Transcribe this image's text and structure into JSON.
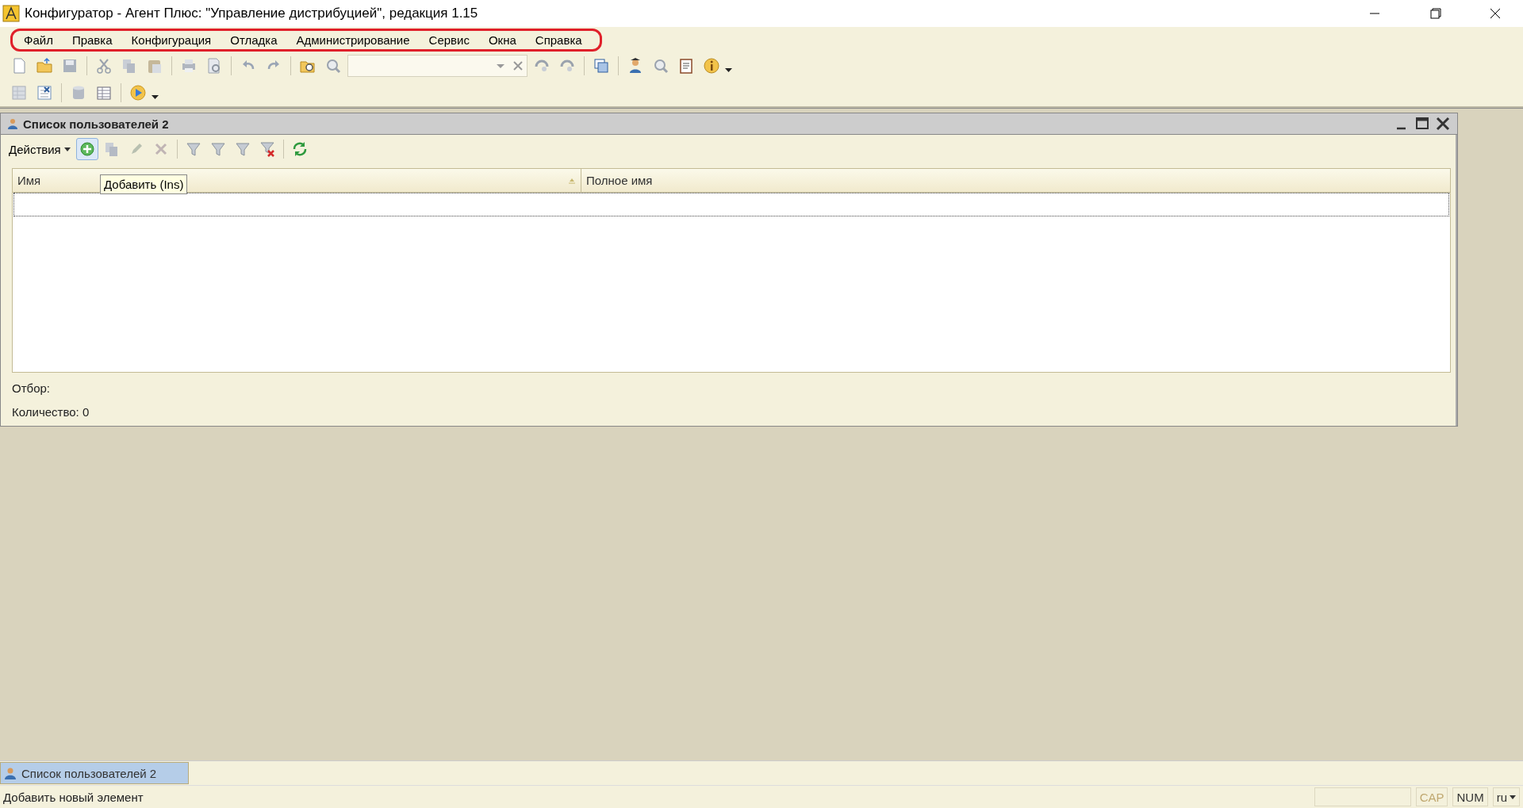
{
  "window": {
    "title": "Конфигуратор - Агент Плюс: \"Управление дистрибуцией\", редакция 1.15"
  },
  "menu": [
    "Файл",
    "Правка",
    "Конфигурация",
    "Отладка",
    "Администрирование",
    "Сервис",
    "Окна",
    "Справка"
  ],
  "child_window": {
    "title": "Список пользователей 2",
    "actions_label": "Действия",
    "tooltip": "Добавить (Ins)",
    "table": {
      "columns": [
        "Имя",
        "Полное имя"
      ]
    },
    "filter_label": "Отбор:",
    "count_label": "Количество: 0"
  },
  "taskbar": [
    {
      "label": "Список пользователей 2",
      "selected": true
    }
  ],
  "status_bar": {
    "message": "Добавить новый элемент",
    "indicators": [
      {
        "label": "CAP",
        "on": false
      },
      {
        "label": "NUM",
        "on": true
      },
      {
        "label": "ru",
        "on": true
      }
    ]
  }
}
